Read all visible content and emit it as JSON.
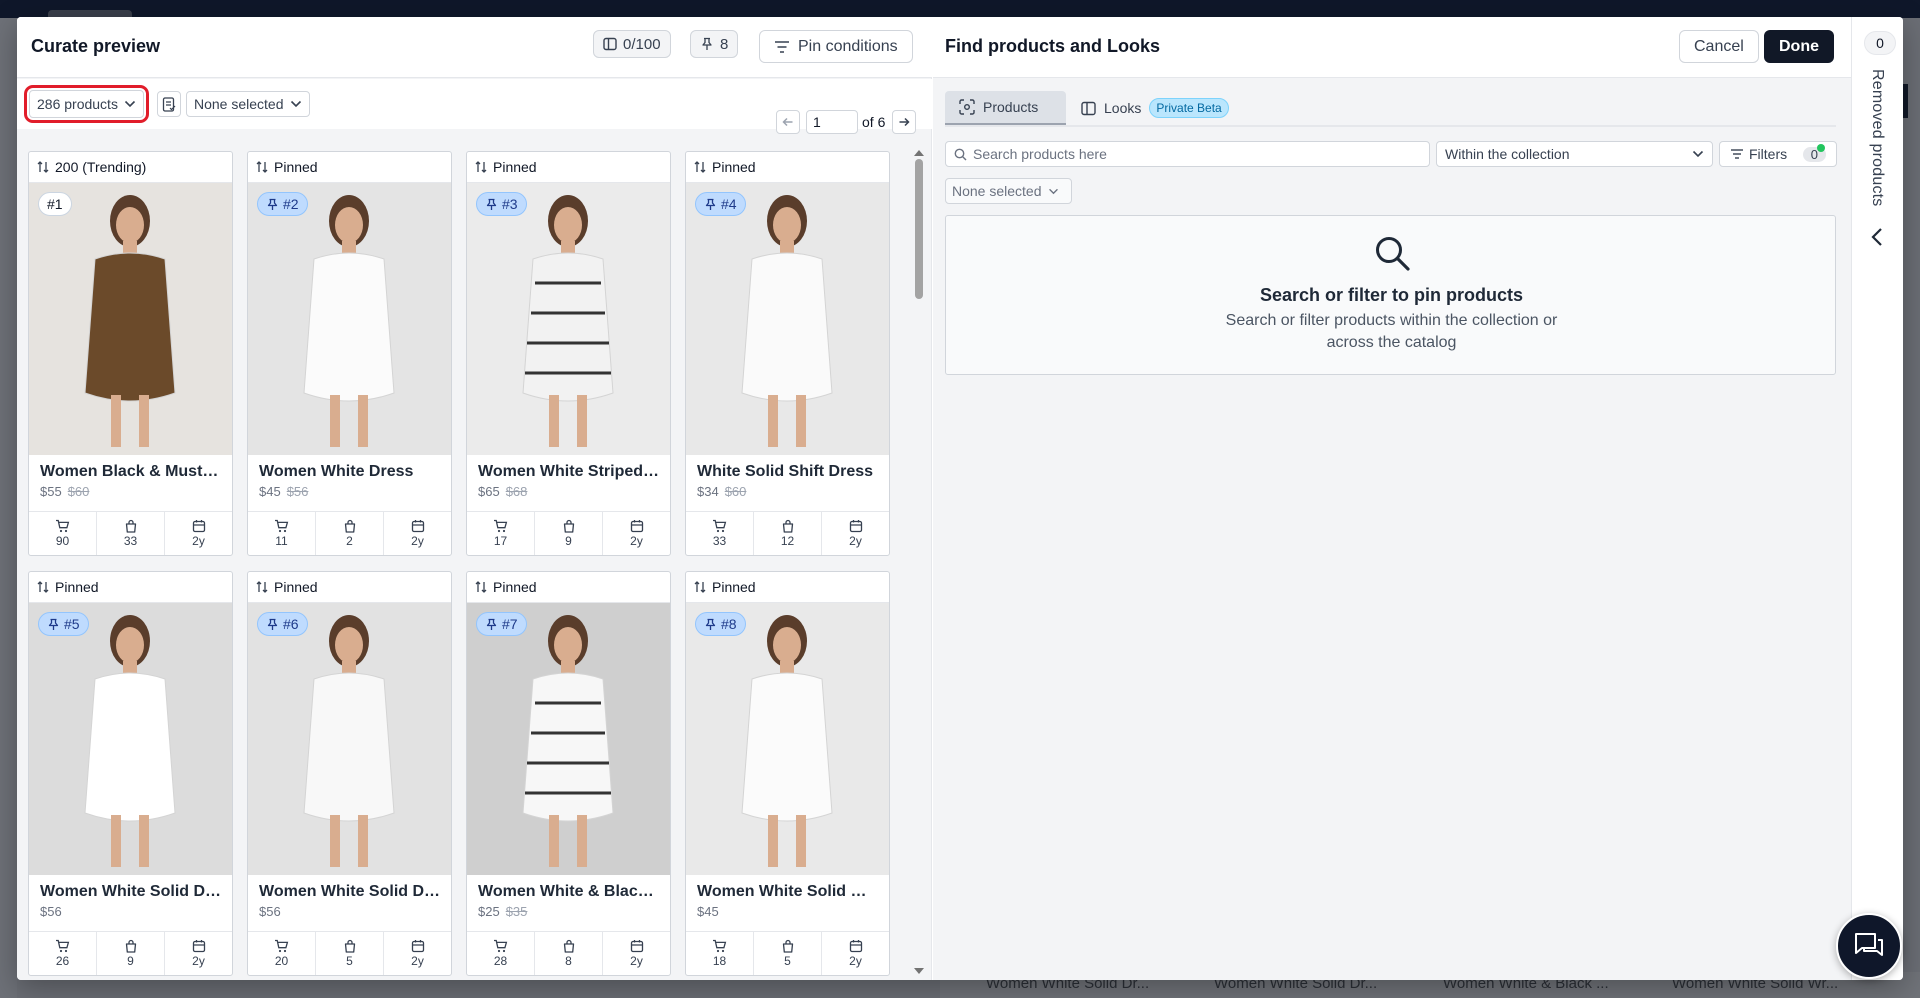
{
  "background": {
    "bottom_items": [
      "Women White Solid Dr...",
      "Women White Solid Dr...",
      "Women White & Black ...",
      "Women White Solid Wr..."
    ]
  },
  "left": {
    "title": "Curate preview",
    "slots_count": "0/100",
    "pinned_count": "8",
    "pin_conditions_label": "Pin conditions",
    "products_dropdown": "286 products",
    "selection_dropdown": "None selected",
    "page_value": "1",
    "page_of": "of 6",
    "products": [
      {
        "head": "200 (Trending)",
        "rank": "#1",
        "pinned": false,
        "name": "Women Black & Mustard Printed Top",
        "price": "$55",
        "old_price": "$60",
        "stats": [
          "90",
          "33",
          "2y"
        ]
      },
      {
        "head": "Pinned",
        "rank": "#2",
        "pinned": true,
        "name": "Women White Dress",
        "price": "$45",
        "old_price": "$56",
        "stats": [
          "11",
          "2",
          "2y"
        ]
      },
      {
        "head": "Pinned",
        "rank": "#3",
        "pinned": true,
        "name": "Women White Striped Dress",
        "price": "$65",
        "old_price": "$68",
        "stats": [
          "17",
          "9",
          "2y"
        ]
      },
      {
        "head": "Pinned",
        "rank": "#4",
        "pinned": true,
        "name": "White Solid Shift Dress",
        "price": "$34",
        "old_price": "$60",
        "stats": [
          "33",
          "12",
          "2y"
        ]
      },
      {
        "head": "Pinned",
        "rank": "#5",
        "pinned": true,
        "name": "Women White Solid Dress",
        "price": "$56",
        "old_price": "",
        "stats": [
          "26",
          "9",
          "2y"
        ]
      },
      {
        "head": "Pinned",
        "rank": "#6",
        "pinned": true,
        "name": "Women White Solid Dress",
        "price": "$56",
        "old_price": "",
        "stats": [
          "20",
          "5",
          "2y"
        ]
      },
      {
        "head": "Pinned",
        "rank": "#7",
        "pinned": true,
        "name": "Women White & Black Striped Dress",
        "price": "$25",
        "old_price": "$35",
        "stats": [
          "28",
          "8",
          "2y"
        ]
      },
      {
        "head": "Pinned",
        "rank": "#8",
        "pinned": true,
        "name": "Women White Solid Wrap Dress",
        "price": "$45",
        "old_price": "",
        "stats": [
          "18",
          "5",
          "2y"
        ]
      }
    ]
  },
  "right": {
    "title": "Find products and Looks",
    "cancel_label": "Cancel",
    "done_label": "Done",
    "tabs": [
      {
        "label": "Products"
      },
      {
        "label": "Looks",
        "badge": "Private Beta"
      }
    ],
    "search_placeholder": "Search products here",
    "scope_value": "Within the collection",
    "filters_label": "Filters",
    "filters_count": "0",
    "selection_dropdown": "None selected",
    "empty_title": "Search or filter to pin products",
    "empty_subtitle": "Search or filter products within the collection or across the catalog"
  },
  "removed": {
    "count": "0",
    "label": "Removed products"
  },
  "colors": {
    "highlight": "#e11d2a",
    "primary": "#111827",
    "pin_badge": "#bfdbfe",
    "status_dot": "#22c55e"
  }
}
